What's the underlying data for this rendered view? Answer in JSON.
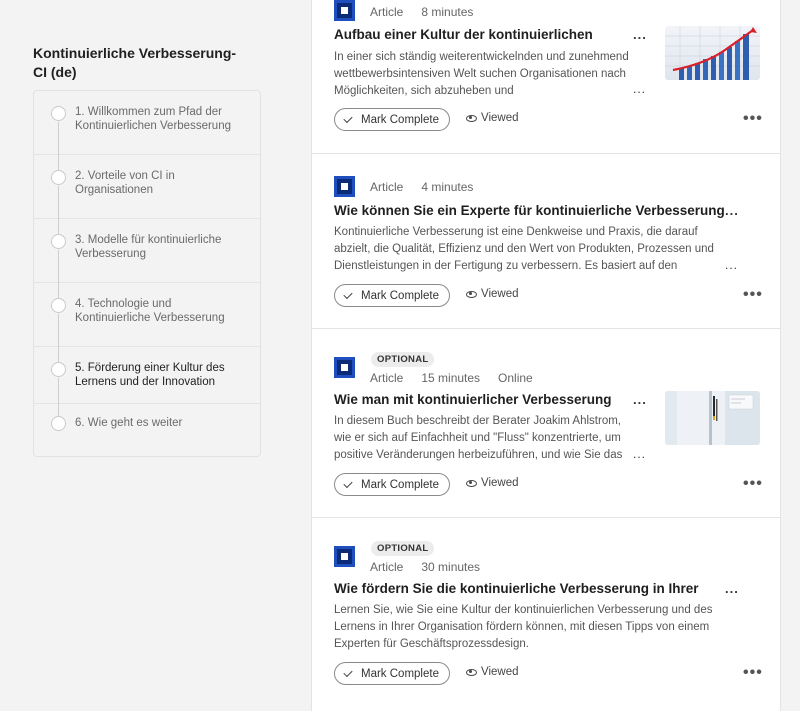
{
  "sidebar": {
    "title": "Kontinuierliche Verbesserung- CI (de)",
    "steps": [
      {
        "label": "1. Willkommen zum Pfad der Kontinuierlichen Verbesserung"
      },
      {
        "label": "2. Vorteile von CI in Organisationen"
      },
      {
        "label": "3. Modelle für kontinuierliche Verbesserung"
      },
      {
        "label": "4. Technologie und Kontinuierliche Verbesserung"
      },
      {
        "label": "5. Förderung einer Kultur des Lernens und der Innovation"
      },
      {
        "label": "6. Wie geht es weiter"
      }
    ]
  },
  "items": [
    {
      "type": "Article",
      "duration": "8 minutes",
      "title": "Aufbau einer Kultur der kontinuierlichen",
      "description": "In einer sich ständig weiterentwickelnden und zunehmend wettbewerbsintensiven Welt suchen Organisationen nach Möglichkeiten, sich abzuheben und",
      "complete_label": "Mark Complete",
      "viewed_label": "Viewed"
    },
    {
      "type": "Article",
      "duration": "4 minutes",
      "title": "Wie können Sie ein Experte für kontinuierliche Verbesserung",
      "description": "Kontinuierliche Verbesserung ist eine Denkweise und Praxis, die darauf abzielt, die Qualität, Effizienz und den Wert von Produkten, Prozessen und Dienstleistungen in der Fertigung zu verbessern. Es basiert auf den",
      "complete_label": "Mark Complete",
      "viewed_label": "Viewed"
    },
    {
      "badge": "OPTIONAL",
      "type": "Article",
      "duration": "15 minutes",
      "format": "Online",
      "title": "Wie man mit kontinuierlicher Verbesserung",
      "description": "In diesem Buch beschreibt der Berater Joakim Ahlstrom, wie er sich auf Einfachheit und \"Fluss\" konzentrierte, um positive Veränderungen herbeizuführen, und wie Sie das",
      "complete_label": "Mark Complete",
      "viewed_label": "Viewed"
    },
    {
      "badge": "OPTIONAL",
      "type": "Article",
      "duration": "30 minutes",
      "title": "Wie fördern Sie die kontinuierliche Verbesserung in Ihrer",
      "description": "Lernen Sie, wie Sie eine Kultur der kontinuierlichen Verbesserung und des Lernens in Ihrer Organisation fördern können, mit diesen Tipps von einem Experten für Geschäftsprozessdesign.",
      "complete_label": "Mark Complete",
      "viewed_label": "Viewed"
    }
  ],
  "ellipsis": "...",
  "more": "•••"
}
